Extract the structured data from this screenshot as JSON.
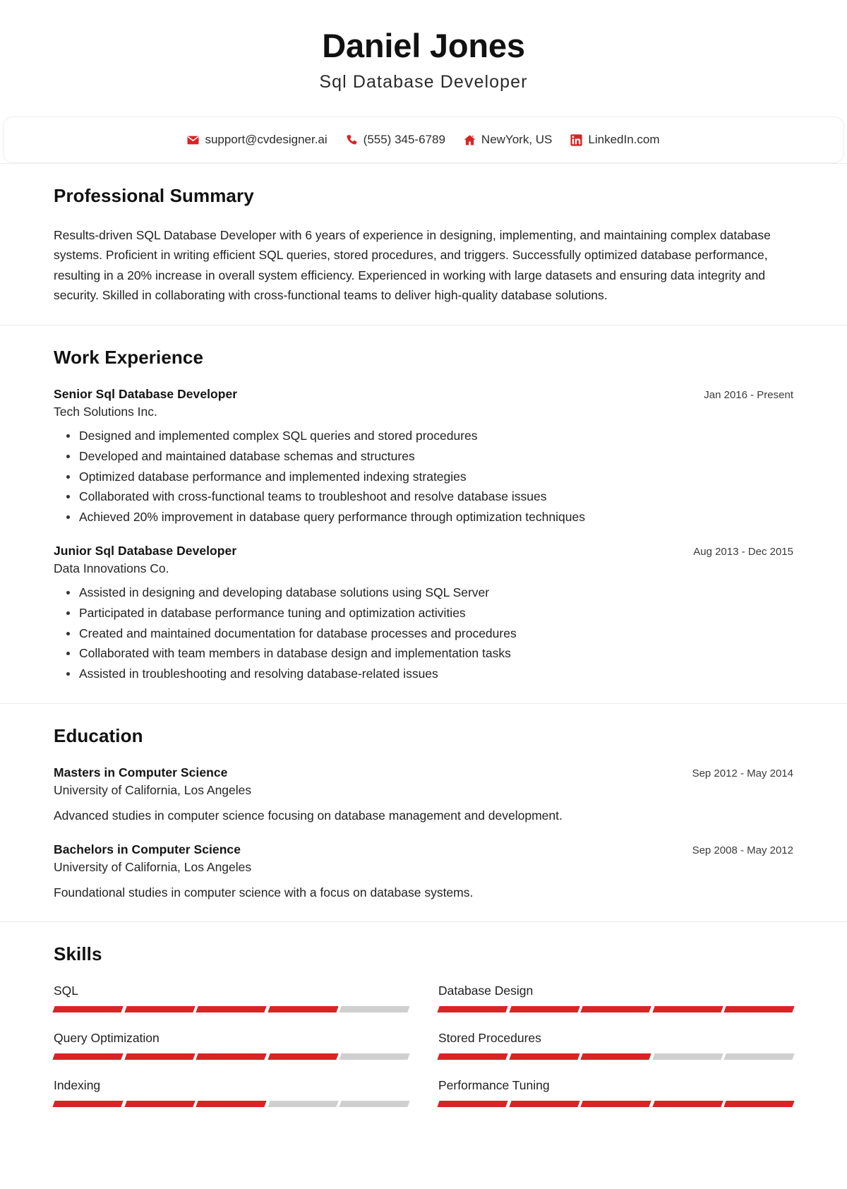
{
  "header": {
    "name": "Daniel Jones",
    "title": "Sql Database Developer"
  },
  "contact": {
    "items": [
      {
        "icon": "email-icon",
        "label": "support@cvdesigner.ai"
      },
      {
        "icon": "phone-icon",
        "label": "(555) 345-6789"
      },
      {
        "icon": "home-icon",
        "label": "NewYork, US"
      },
      {
        "icon": "linkedin-icon",
        "label": "LinkedIn.com"
      }
    ]
  },
  "summary": {
    "heading": "Professional Summary",
    "text": "Results-driven SQL Database Developer with 6 years of experience in designing, implementing, and maintaining complex database systems. Proficient in writing efficient SQL queries, stored procedures, and triggers. Successfully optimized database performance, resulting in a 20% increase in overall system efficiency. Experienced in working with large datasets and ensuring data integrity and security. Skilled in collaborating with cross-functional teams to deliver high-quality database solutions."
  },
  "work": {
    "heading": "Work Experience",
    "entries": [
      {
        "role": "Senior Sql Database Developer",
        "org": "Tech Solutions Inc.",
        "date": "Jan 2016 - Present",
        "bullets": [
          "Designed and implemented complex SQL queries and stored procedures",
          "Developed and maintained database schemas and structures",
          "Optimized database performance and implemented indexing strategies",
          "Collaborated with cross-functional teams to troubleshoot and resolve database issues",
          "Achieved 20% improvement in database query performance through optimization techniques"
        ]
      },
      {
        "role": "Junior Sql Database Developer",
        "org": "Data Innovations Co.",
        "date": "Aug 2013 - Dec 2015",
        "bullets": [
          "Assisted in designing and developing database solutions using SQL Server",
          "Participated in database performance tuning and optimization activities",
          "Created and maintained documentation for database processes and procedures",
          "Collaborated with team members in database design and implementation tasks",
          "Assisted in troubleshooting and resolving database-related issues"
        ]
      }
    ]
  },
  "education": {
    "heading": "Education",
    "entries": [
      {
        "degree": "Masters in Computer Science",
        "school": "University of California, Los Angeles",
        "date": "Sep 2012 - May 2014",
        "description": "Advanced studies in computer science focusing on database management and development."
      },
      {
        "degree": "Bachelors in Computer Science",
        "school": "University of California, Los Angeles",
        "date": "Sep 2008 - May 2012",
        "description": "Foundational studies in computer science with a focus on database systems."
      }
    ]
  },
  "skills": {
    "heading": "Skills",
    "segments_total": 5,
    "items": [
      {
        "name": "SQL",
        "filled": 4
      },
      {
        "name": "Database Design",
        "filled": 5
      },
      {
        "name": "Query Optimization",
        "filled": 4
      },
      {
        "name": "Stored Procedures",
        "filled": 3
      },
      {
        "name": "Indexing",
        "filled": 3
      },
      {
        "name": "Performance Tuning",
        "filled": 5
      }
    ]
  },
  "colors": {
    "accent": "#d82424",
    "bar_empty": "#cfcfcf",
    "text": "#1a1a1a",
    "divider": "#ececec"
  }
}
